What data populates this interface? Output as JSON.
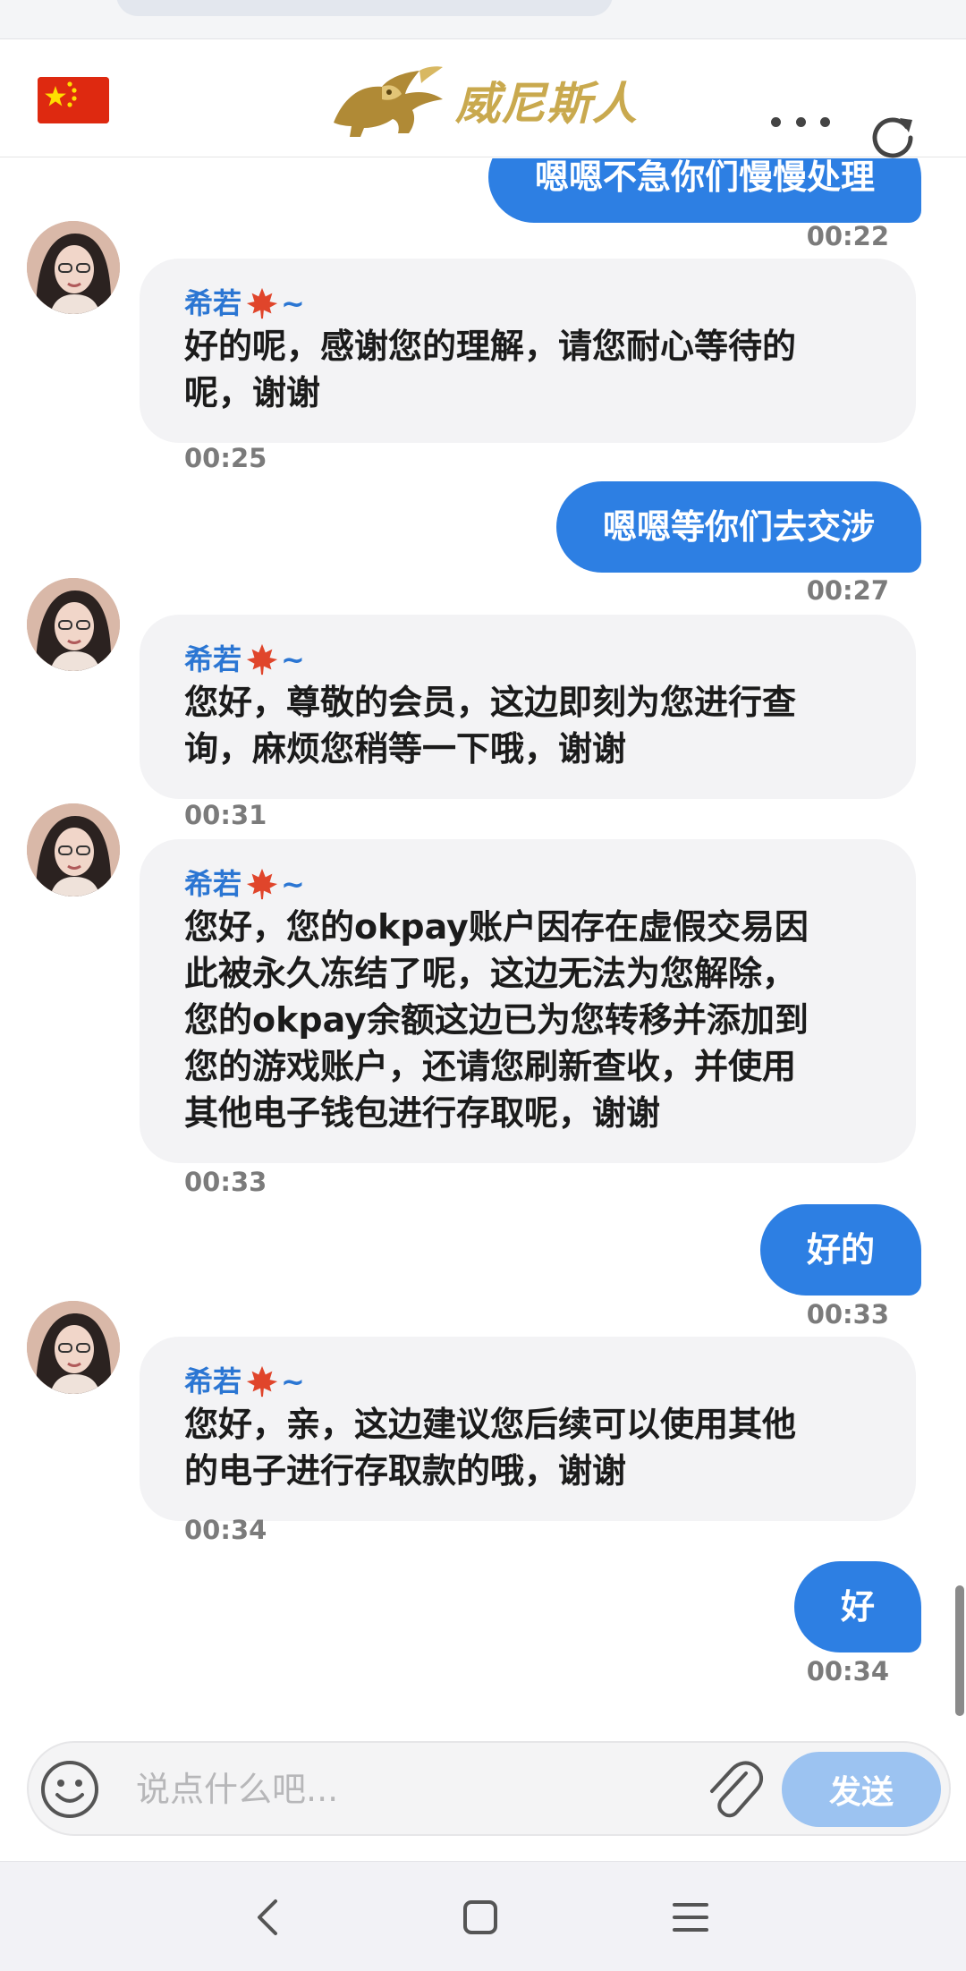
{
  "header": {
    "flag_icon": "china-flag-icon",
    "logo_text": "威尼斯人",
    "menu_icon": "more-dots-icon",
    "refresh_icon": "refresh-icon"
  },
  "messages": [
    {
      "type": "out",
      "text": "嗯嗯不急你们慢慢处理",
      "time": "00:22"
    },
    {
      "type": "in",
      "agent": "希若",
      "text_lines": [
        "好的呢，感谢您的理解，请您耐心等待的",
        "呢，谢谢"
      ],
      "time": "00:25"
    },
    {
      "type": "out",
      "text": "嗯嗯等你们去交涉",
      "time": "00:27"
    },
    {
      "type": "in",
      "agent": "希若",
      "text_lines": [
        "您好，尊敬的会员，这边即刻为您进行查",
        "询，麻烦您稍等一下哦，谢谢"
      ],
      "time": "00:31"
    },
    {
      "type": "in",
      "agent": "希若",
      "text_lines": [
        "您好，您的okpay账户因存在虚假交易因",
        "此被永久冻结了呢，这边无法为您解除，",
        "您的okpay余额这边已为您转移并添加到",
        "您的游戏账户，还请您刷新查收，并使用",
        "其他电子钱包进行存取呢，谢谢"
      ],
      "time": "00:33"
    },
    {
      "type": "out",
      "text": "好的",
      "time": "00:33"
    },
    {
      "type": "in",
      "agent": "希若",
      "text_lines": [
        "您好，亲，这边建议您后续可以使用其他",
        "的电子进行存取款的哦，谢谢"
      ],
      "time": "00:34"
    },
    {
      "type": "out",
      "text": "好",
      "time": "00:34"
    }
  ],
  "agent_suffix": "~",
  "composer": {
    "placeholder": "说点什么吧...",
    "send_label": "发送",
    "emoji_icon": "emoji-icon",
    "attach_icon": "paperclip-icon"
  },
  "colors": {
    "accent": "#2d7fe3",
    "send_disabled": "#9cc3f1",
    "incoming_bubble": "#f3f3f5",
    "logo_gold": "#c9a94e"
  }
}
